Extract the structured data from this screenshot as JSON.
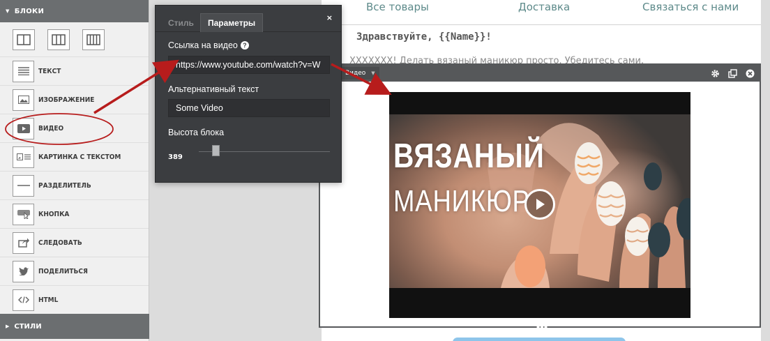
{
  "sidebar": {
    "blocks_header": "БЛОКИ",
    "styles_header": "СТИЛИ",
    "layouts": [
      "one-column",
      "two-column",
      "three-column"
    ],
    "items": [
      {
        "label": "ТЕКСТ",
        "icon": "text-lines-icon"
      },
      {
        "label": "ИЗОБРАЖЕНИЕ",
        "icon": "image-icon"
      },
      {
        "label": "ВИДЕО",
        "icon": "video-play-icon"
      },
      {
        "label": "КАРТИНКА С ТЕКСТОМ",
        "icon": "image-with-text-icon"
      },
      {
        "label": "РАЗДЕЛИТЕЛЬ",
        "icon": "divider-icon"
      },
      {
        "label": "КНОПКА",
        "icon": "button-cursor-icon"
      },
      {
        "label": "СЛЕДОВАТЬ",
        "icon": "share-arrow-icon"
      },
      {
        "label": "ПОДЕЛИТЬСЯ",
        "icon": "twitter-bird-icon"
      },
      {
        "label": "HTML",
        "icon": "code-icon"
      }
    ]
  },
  "email": {
    "nav": [
      "Все товары",
      "Доставка",
      "Связаться с нами"
    ],
    "greeting": "Здравствуйте, {{Name}}!",
    "intro_text": "XXXXXXX! Делать вязаный маникюр просто. Убедитесь сами."
  },
  "video_block": {
    "tag": "Видео",
    "thumbnail_title_line1": "ВЯЗАНЫЙ",
    "thumbnail_title_line2": "МАНИКЮР"
  },
  "popup": {
    "tab_style": "Стиль",
    "tab_params": "Параметры",
    "close": "×",
    "video_url_label": "Ссылка на видео",
    "video_url_value": "https://www.youtube.com/watch?v=W",
    "alt_text_label": "Альтернативный текст",
    "alt_text_value": "Some Video",
    "height_label": "Высота блока",
    "height_value": "389"
  },
  "colors": {
    "sidebar_header": "#6b6e70",
    "popup_bg": "#3b3d40",
    "nav_link": "#5d8a8a",
    "annotation_red": "#b71c1c"
  }
}
